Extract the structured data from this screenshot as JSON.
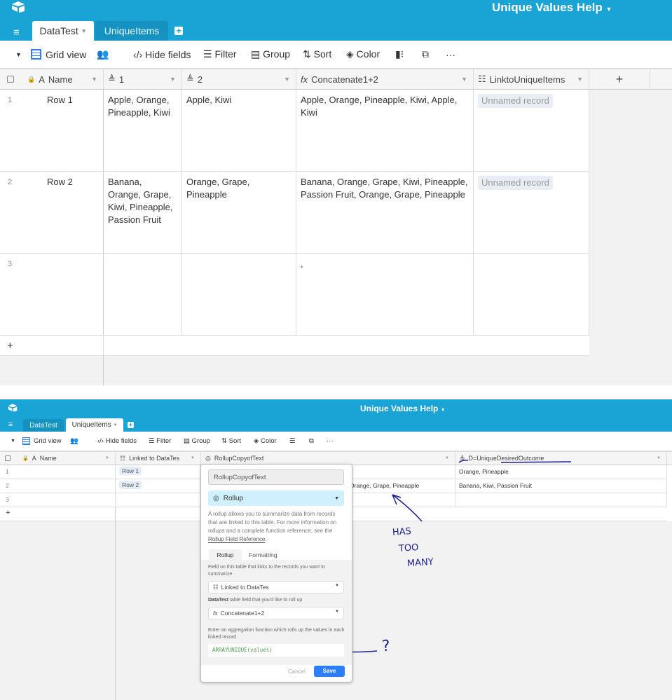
{
  "top": {
    "app_title": "Unique Values Help",
    "tabs": [
      {
        "label": "DataTest",
        "active": true
      },
      {
        "label": "UniqueItems",
        "active": false
      }
    ],
    "toolbar": {
      "view": "Grid view",
      "hide_fields": "Hide fields",
      "filter": "Filter",
      "group": "Group",
      "sort": "Sort",
      "color": "Color",
      "more": "···"
    },
    "columns": [
      "Name",
      "1",
      "2",
      "Concatenate1+2",
      "LinktoUniqueItems",
      "+"
    ],
    "rows": [
      {
        "num": "1",
        "name": "Row 1",
        "c1": "Apple, Orange, Pineapple, Kiwi",
        "c2": "Apple, Kiwi",
        "concat": "Apple, Orange, Pineapple, Kiwi, Apple, Kiwi",
        "link": "Unnamed record"
      },
      {
        "num": "2",
        "name": "Row 2",
        "c1": "Banana, Orange, Grape, Kiwi, Pineapple, Passion Fruit",
        "c2": "Orange, Grape, Pineapple",
        "concat": "Banana, Orange, Grape, Kiwi, Pineapple, Passion Fruit, Orange, Grape, Pineapple",
        "link": "Unnamed record"
      },
      {
        "num": "3",
        "name": "",
        "c1": "",
        "c2": "",
        "concat": ",",
        "link": ""
      }
    ],
    "add_row": "+"
  },
  "bottom": {
    "app_title": "Unique Values Help",
    "tabs": [
      {
        "label": "DataTest",
        "active": false
      },
      {
        "label": "UniqueItems",
        "active": true
      }
    ],
    "toolbar": {
      "view": "Grid view",
      "hide_fields": "Hide fields",
      "filter": "Filter",
      "group": "Group",
      "sort": "Sort",
      "color": "Color",
      "more": "···"
    },
    "columns": [
      "Name",
      "Linked to DataTes",
      "RollupCopyofText",
      "D=UniqueDesiredOutcome"
    ],
    "rows": [
      {
        "num": "1",
        "linked": "Row 1",
        "rollup": "",
        "outcome": "Orange, Pineapple"
      },
      {
        "num": "2",
        "linked": "Row 2",
        "rollup": "Orange, Grape, Pineapple",
        "outcome": "Banana, Kiwi, Passion Fruit"
      },
      {
        "num": "3",
        "linked": "",
        "rollup": "",
        "outcome": ""
      }
    ],
    "add_row": "+"
  },
  "popup": {
    "field_name": "RollupCopyofText",
    "field_type": "Rollup",
    "description": "A rollup allows you to summarize data from records that are linked to this table. For more information on rollups and a complete function reference, see the ",
    "link": "Rollup Field Reference",
    "link_end": ".",
    "tabs": [
      "Rollup",
      "Formatting"
    ],
    "link_field_label": "Field on this table that links to the records you want to summarize",
    "link_field_value": "Linked to DataTes",
    "rollup_field_label_bold": "DataTest",
    "rollup_field_label": " table field that you'd like to roll up",
    "rollup_field_value": "Concatenate1+2",
    "agg_label": "Enter an aggregation function which rolls up the values in each linked record",
    "formula": "ARRAYUNIQUE(values)",
    "cancel": "Cancel",
    "save": "Save"
  },
  "annotations": {
    "too_many": [
      "HAS",
      "TOO",
      "MANY"
    ],
    "question": "?"
  },
  "colors": {
    "header": "#1aa3d5",
    "save": "#2d7ff9",
    "rollup_select": "#d0f0fd"
  }
}
